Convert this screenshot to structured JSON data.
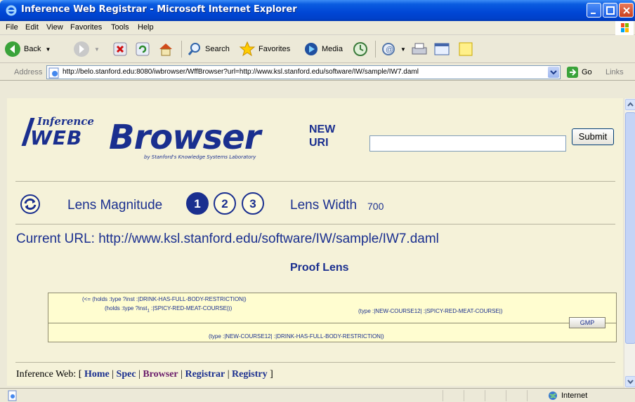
{
  "window": {
    "title": "Inference Web Registrar - Microsoft Internet Explorer"
  },
  "menu": {
    "items": [
      "File",
      "Edit",
      "View",
      "Favorites",
      "Tools",
      "Help"
    ]
  },
  "toolbar": {
    "back_label": "Back",
    "search_label": "Search",
    "favorites_label": "Favorites",
    "media_label": "Media"
  },
  "address": {
    "label": "Address",
    "url": "http://belo.stanford.edu:8080/iwbrowser/WffBrowser?url=http://www.ksl.stanford.edu/software/IW/sample/IW7.daml",
    "go_label": "Go",
    "links_label": "Links"
  },
  "page": {
    "logo": {
      "inference": "Inference",
      "web": "WEB",
      "browser": "Browser",
      "subtitle": "by Stanford's Knowledge Systems Laboratory"
    },
    "new_uri_label_1": "NEW",
    "new_uri_label_2": "URI",
    "uri_value": "",
    "submit_label": "Submit",
    "lens_magnitude_label": "Lens Magnitude",
    "magnitude_options": [
      "1",
      "2",
      "3"
    ],
    "selected_magnitude": "1",
    "lens_width_label": "Lens Width",
    "lens_width_value": "700",
    "current_url_label": "Current URL: http://www.ksl.stanford.edu/software/IW/sample/IW7.daml",
    "proof_lens_title": "Proof Lens",
    "proof": {
      "premise_1": "(<= (holds :type ?inst :|DRINK-HAS-FULL-BODY-RESTRICTION|)",
      "premise_2": "(holds :type ?inst",
      "premise_2_sub": "1",
      "premise_2_rest": " :|SPICY-RED-MEAT-COURSE|))",
      "premise_3": "(type :|NEW-COURSE12| :|SPICY-RED-MEAT-COURSE|)",
      "conclusion": "(type :|NEW-COURSE12| :|DRINK-HAS-FULL-BODY-RESTRICTION|)",
      "rule_label": "GMP"
    },
    "footer": {
      "prefix": "Inference Web: [ ",
      "links": [
        "Home",
        "Spec",
        "Browser",
        "Registrar",
        "Registry"
      ],
      "suffix": " ]"
    }
  },
  "status": {
    "zone_label": "Internet"
  },
  "colors": {
    "title_blue": "#0046d5",
    "page_bg": "#f5f2d9",
    "text_navy": "#1a2f8f",
    "proof_bg": "#fffdd0"
  }
}
